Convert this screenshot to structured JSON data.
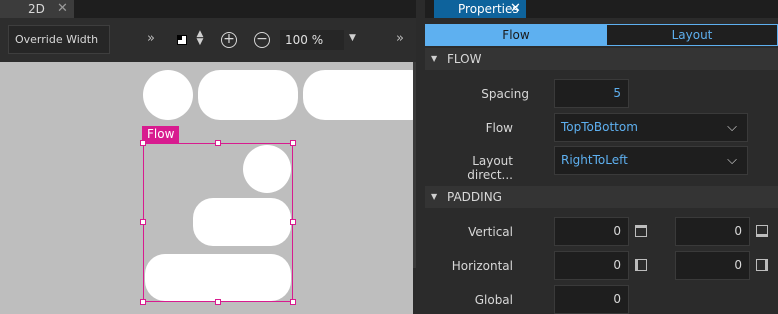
{
  "viewport": {
    "tab_label": "2D",
    "override_label": "Override Width",
    "zoom_value": "100 %",
    "overflow_glyph": "»",
    "plus_glyph": "+",
    "minus_glyph": "−",
    "close_glyph": "✕",
    "selection_label": "Flow",
    "selection_color": "#d81b8f"
  },
  "properties": {
    "tab_label": "Properties",
    "close_glyph": "✕",
    "segments": {
      "active": "Flow",
      "inactive": "Layout"
    },
    "accent_color": "#5eb0f0",
    "sections": {
      "flow": {
        "title": "FLOW",
        "spacing_label": "Spacing",
        "spacing_value": "5",
        "flow_label": "Flow",
        "flow_value": "TopToBottom",
        "layout_direction_label": "Layout direct...",
        "layout_direction_value": "RightToLeft"
      },
      "padding": {
        "title": "PADDING",
        "vertical_label": "Vertical",
        "vertical_top": "0",
        "vertical_bottom": "0",
        "horizontal_label": "Horizontal",
        "horizontal_left": "0",
        "horizontal_right": "0",
        "global_label": "Global",
        "global_value": "0"
      }
    }
  }
}
